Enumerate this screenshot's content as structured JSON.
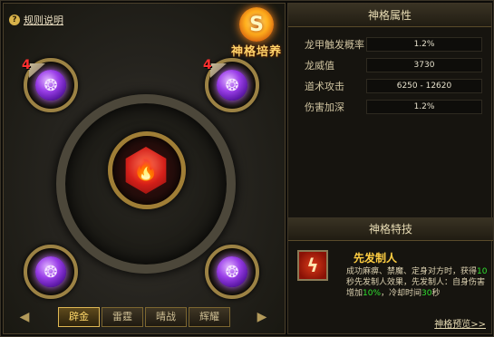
{
  "left": {
    "help_label": "规则说明",
    "train_label": "神格培养",
    "train_glyph": "S",
    "core_glyph": "🔥",
    "slots": [
      {
        "badge": "4",
        "glyph": "❂"
      },
      {
        "badge": "4",
        "glyph": "❂"
      },
      {
        "badge": "",
        "glyph": "❂"
      },
      {
        "badge": "",
        "glyph": "❂"
      }
    ],
    "tabs": [
      "辟金",
      "雷霆",
      "晴战",
      "辉耀"
    ],
    "prev_arrow": "◀",
    "next_arrow": "▶"
  },
  "attributes": {
    "title": "神格属性",
    "rows": [
      {
        "name": "龙甲触发概率",
        "value": "1.2%"
      },
      {
        "name": "龙威值",
        "value": "3730"
      },
      {
        "name": "道术攻击",
        "value": "6250 - 12620"
      },
      {
        "name": "伤害加深",
        "value": "1.2%"
      }
    ]
  },
  "skill": {
    "title": "神格特技",
    "icon_glyph": "ϟ",
    "name": "先发制人",
    "desc_1": "成功麻痹、禁魔、定身对方时，获得",
    "desc_hl_1": "10",
    "desc_2": "秒先发制人效果，先发制人：自身伤害增加",
    "desc_hl_2": "10%",
    "desc_3": "，冷却时间",
    "desc_hl_3": "30",
    "desc_4": "秒",
    "preview": "神格预览>>"
  },
  "colors": {
    "accent_gold": "#ffce42",
    "highlight_green": "#2fe02f",
    "orb_purple": "#9a3ee8",
    "core_red": "#d4201a"
  }
}
